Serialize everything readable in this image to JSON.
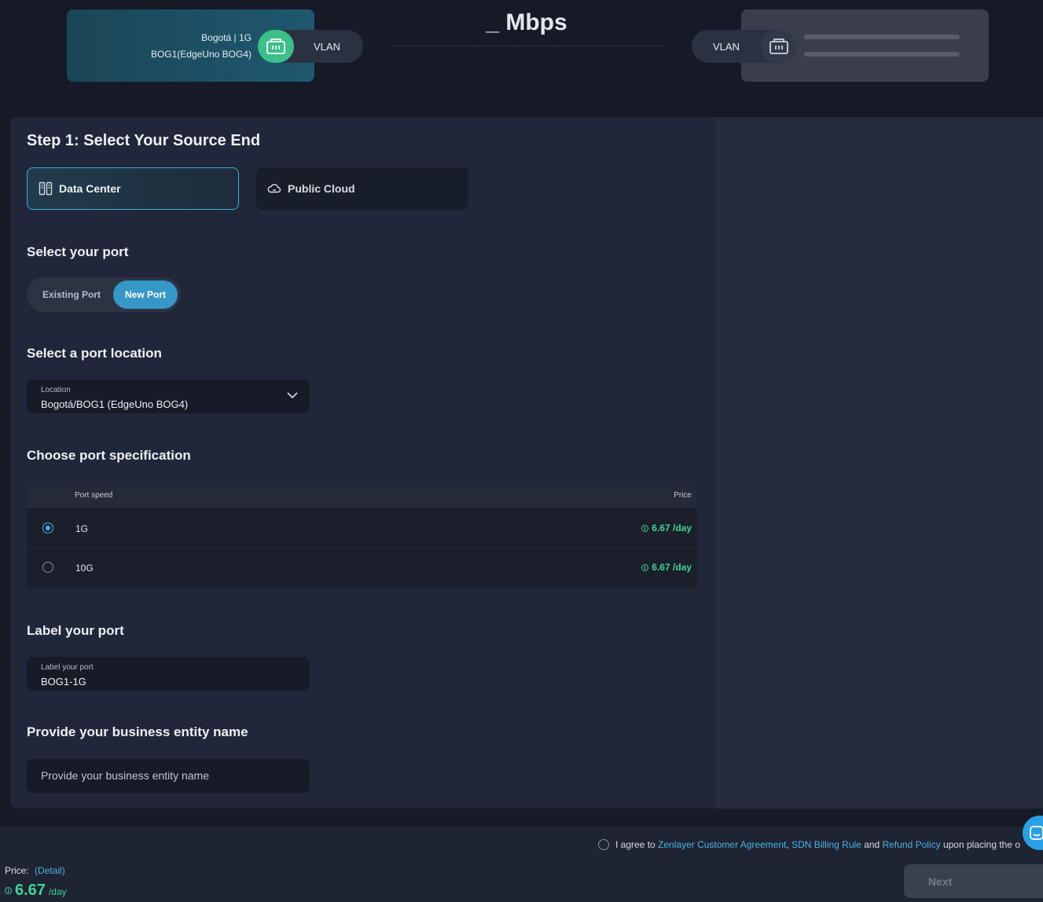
{
  "top_bar": {
    "source": {
      "location_line": "Bogotá | 1G",
      "site_line": "BOG1(EdgeUno BOG4)",
      "vlan_label": "VLAN"
    },
    "bandwidth": "_ Mbps",
    "destination": {
      "vlan_label": "VLAN"
    }
  },
  "step": {
    "title": "Step 1: Select Your Source End",
    "options": [
      {
        "label": "Data Center",
        "icon": "data-center-icon",
        "selected": true
      },
      {
        "label": "Public Cloud",
        "icon": "cloud-icon",
        "selected": false
      }
    ]
  },
  "port_select": {
    "heading": "Select your port",
    "existing_label": "Existing Port",
    "new_label": "New Port",
    "selected": "New Port"
  },
  "location": {
    "heading": "Select a port location",
    "field_label": "Location",
    "value": "Bogotá/BOG1 (EdgeUno BOG4)"
  },
  "spec": {
    "heading": "Choose port specification",
    "col_speed": "Port speed",
    "col_price": "Price",
    "rows": [
      {
        "speed": "1G",
        "price": "6.67 /day",
        "selected": true
      },
      {
        "speed": "10G",
        "price": "6.67 /day",
        "selected": false
      }
    ]
  },
  "label_port": {
    "heading": "Label your port",
    "field_label": "Label your port",
    "value": "BOG1-1G"
  },
  "business": {
    "heading": "Provide your business entity name",
    "placeholder": "Provide your business entity name"
  },
  "footer": {
    "agree_prefix": "I agree to",
    "link_agreement": "Zenlayer Customer Agreement",
    "sep1": ",",
    "link_billing": "SDN Billing Rule",
    "and": "and",
    "link_refund": "Refund Policy",
    "agree_suffix": "upon placing the o",
    "price_label": "Price:",
    "detail_link": "(Detail)",
    "price_amount": "6.67",
    "price_unit": "/day",
    "next_label": "Next"
  },
  "colors": {
    "accent": "#3797c6",
    "price_green": "#40d39a",
    "port_green": "#3cc08a",
    "background": "#161a26"
  }
}
